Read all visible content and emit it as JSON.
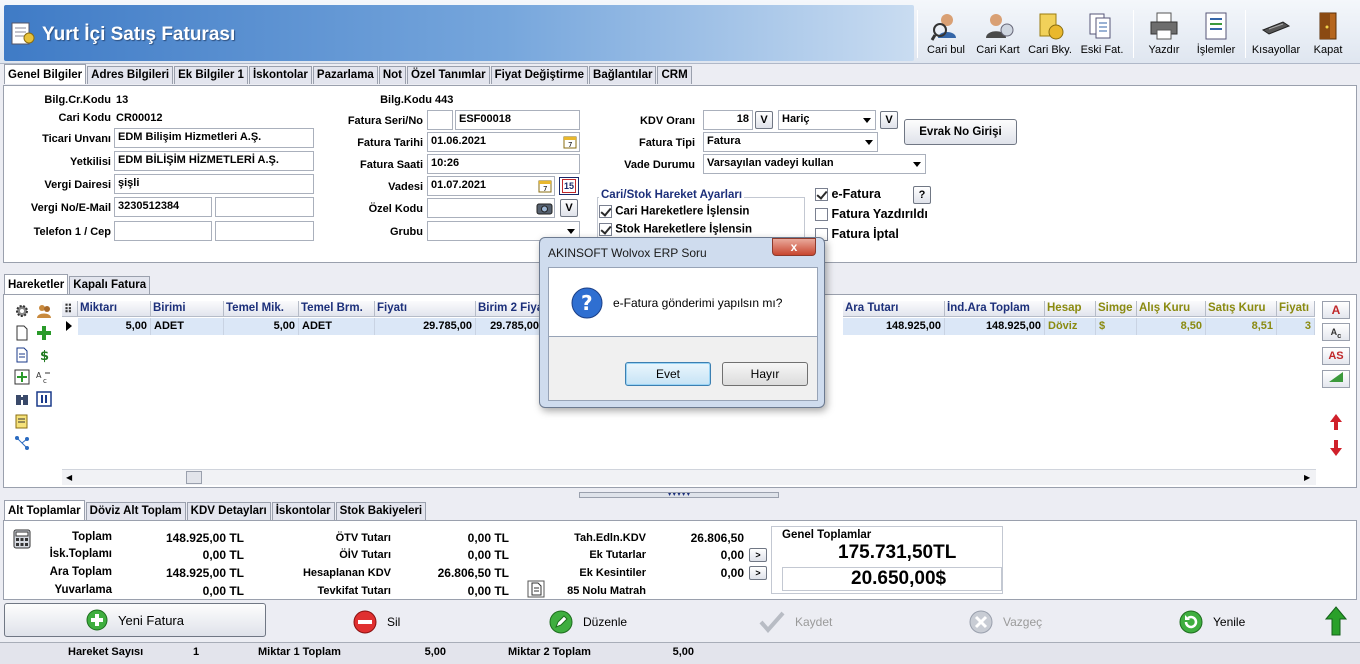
{
  "header": {
    "title": "Yurt İçi Satış Faturası",
    "toolbar": [
      {
        "label": "Cari bul",
        "icon": "find-customer-icon"
      },
      {
        "label": "Cari Kart",
        "icon": "customer-card-icon"
      },
      {
        "label": "Cari Bky.",
        "icon": "customer-balance-icon"
      },
      {
        "label": "Eski Fat.",
        "icon": "old-invoices-icon"
      },
      {
        "label": "Yazdır",
        "icon": "printer-icon"
      },
      {
        "label": "İşlemler",
        "icon": "operations-icon"
      },
      {
        "label": "Kısayollar",
        "icon": "shortcuts-icon"
      },
      {
        "label": "Kapat",
        "icon": "close-door-icon"
      }
    ]
  },
  "tabs": [
    "Genel Bilgiler",
    "Adres Bilgileri",
    "Ek Bilgiler 1",
    "İskontolar",
    "Pazarlama",
    "Not",
    "Özel Tanımlar",
    "Fiyat Değiştirme",
    "Bağlantılar",
    "CRM"
  ],
  "form": {
    "bilg_cr_kodu_label": "Bilg.Cr.Kodu",
    "bilg_cr_kodu": "13",
    "cari_kodu_label": "Cari Kodu",
    "cari_kodu": "CR00012",
    "ticari_unvani_label": "Ticari Unvanı",
    "ticari_unvani": "EDM Bilişim Hizmetleri A.Ş.",
    "yetkilisi_label": "Yetkilisi",
    "yetkilisi": "EDM BİLİŞİM HİZMETLERİ A.Ş.",
    "vergi_dairesi_label": "Vergi Dairesi",
    "vergi_dairesi": "şişli",
    "vergi_no_label": "Vergi No/E-Mail",
    "vergi_no": "3230512384",
    "telefon_label": "Telefon 1 / Cep",
    "bilg_kodu_label": "Bilg.Kodu",
    "bilg_kodu": "443",
    "fatura_seri_label": "Fatura Seri/No",
    "fatura_no": "ESF00018",
    "fatura_tarihi_label": "Fatura Tarihi",
    "fatura_tarihi": "01.06.2021",
    "fatura_saati_label": "Fatura Saati",
    "fatura_saati": "10:26",
    "vadesi_label": "Vadesi",
    "vadesi": "01.07.2021",
    "ozel_kodu_label": "Özel Kodu",
    "grubu_label": "Grubu",
    "kdv_orani_label": "KDV Oranı",
    "kdv_orani": "18",
    "kdv_tipi": "Hariç",
    "fatura_tipi_label": "Fatura Tipi",
    "fatura_tipi": "Fatura",
    "vade_durumu_label": "Vade Durumu",
    "vade_durumu": "Varsayılan vadeyi kullan",
    "evrak_button": "Evrak No Girişi",
    "v_button": "V",
    "cal_badge": "15",
    "hareket_group_title": "Cari/Stok Hareket Ayarları",
    "cari_hareket": "Cari Hareketlere İşlensin",
    "stok_hareket": "Stok Hareketlere İşlensin",
    "efatura": "e-Fatura",
    "fatura_yazdirildi": "Fatura Yazdırıldı",
    "fatura_iptal": "Fatura İptal",
    "help": "?"
  },
  "grid_tabs": [
    "Hareketler",
    "Kapalı Fatura"
  ],
  "grid": {
    "headers": {
      "miktari": "Miktarı",
      "birimi": "Birimi",
      "temel_mik": "Temel Mik.",
      "temel_brm": "Temel Brm.",
      "fiyati": "Fiyatı",
      "birim2": "Birim 2 Fiyatı",
      "ara_tutari": "Ara Tutarı",
      "ind_ara": "İnd.Ara Toplam",
      "hesap": "Hesap",
      "simge": "Simge",
      "alis_kuru": "Alış Kuru",
      "satis_kuru": "Satış Kuru",
      "fiyati2": "Fiyatı"
    },
    "row": {
      "miktari": "5,00",
      "birimi": "ADET",
      "temel_mik": "5,00",
      "temel_brm": "ADET",
      "fiyati": "29.785,00",
      "birim2": "29.785,00",
      "ara_tutari": "148.925,00",
      "ind_ara": "148.925,00",
      "hesap": "Döviz",
      "simge": "$",
      "alis_kuru": "8,50",
      "satis_kuru": "8,51",
      "fiyati2": "3"
    },
    "right_buttons": [
      "A",
      "AS"
    ]
  },
  "bottom_tabs": [
    "Alt Toplamlar",
    "Döviz Alt Toplam",
    "KDV Detayları",
    "İskontolar",
    "Stok Bakiyeleri"
  ],
  "totals": {
    "toplam_label": "Toplam",
    "toplam": "148.925,00 TL",
    "isk_label": "İsk.Toplamı",
    "isk": "0,00 TL",
    "ara_label": "Ara Toplam",
    "ara": "148.925,00 TL",
    "yuvarlama_label": "Yuvarlama",
    "yuvarlama": "0,00 TL",
    "otv_label": "ÖTV Tutarı",
    "otv": "0,00 TL",
    "oiv_label": "ÖİV Tutarı",
    "oiv": "0,00 TL",
    "kdv_label": "Hesaplanan KDV",
    "kdv": "26.806,50 TL",
    "tevkifat_label": "Tevkifat Tutarı",
    "tevkifat": "0,00 TL",
    "tah_label": "Tah.Edln.KDV",
    "tah": "26.806,50",
    "ek_tutar_label": "Ek Tutarlar",
    "ek_tutar": "0,00",
    "ek_kesinti_label": "Ek Kesintiler",
    "ek_kesinti": "0,00",
    "matrah_label": "85 Nolu Matrah",
    "genel_label": "Genel Toplamlar",
    "genel_tl": "175.731,50TL",
    "genel_usd": "20.650,00$"
  },
  "actions": {
    "yeni": "Yeni Fatura",
    "sil": "Sil",
    "duzenle": "Düzenle",
    "kaydet": "Kaydet",
    "vazgec": "Vazgeç",
    "yenile": "Yenile"
  },
  "status": {
    "hareket_label": "Hareket Sayısı",
    "hareket": "1",
    "miktar1_label": "Miktar 1 Toplam",
    "miktar1": "5,00",
    "miktar2_label": "Miktar 2 Toplam",
    "miktar2": "5,00"
  },
  "dialog": {
    "title": "AKINSOFT Wolvox ERP Soru",
    "message": "e-Fatura gönderimi yapılsın mı?",
    "yes": "Evet",
    "no": "Hayır",
    "close": "x"
  },
  "colors": {
    "accent": "#3f7bc6",
    "grid_header": "#1c2f7a",
    "olive": "#8a8a10"
  }
}
